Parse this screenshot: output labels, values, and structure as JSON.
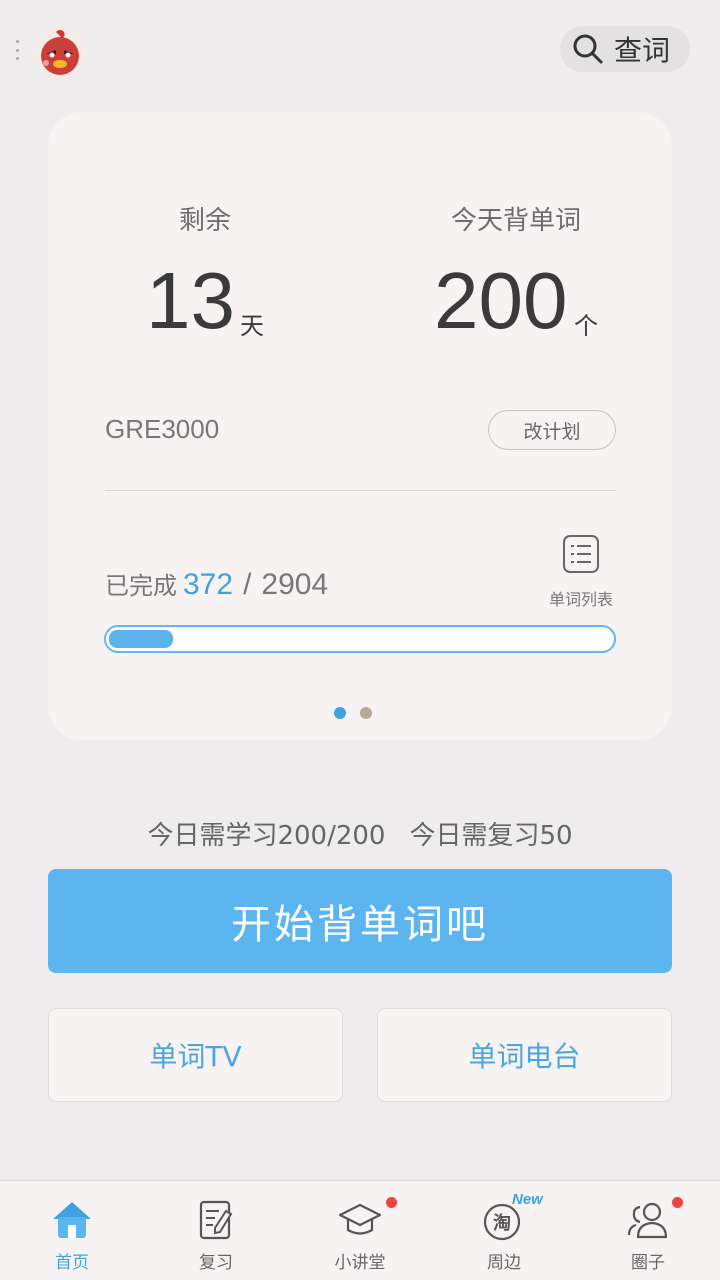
{
  "header": {
    "search_label": "查词"
  },
  "plan_card": {
    "remaining_label": "剩余",
    "remaining_value": "13",
    "remaining_unit": "天",
    "daily_label": "今天背单词",
    "daily_value": "200",
    "daily_unit": "个",
    "book_name": "GRE3000",
    "change_plan_label": "改计划",
    "completed_label": "已完成",
    "completed_count": "372",
    "separator": "/",
    "total_count": "2904",
    "progress_fraction": 0.128,
    "word_list_label": "单词列表",
    "page_indicator": {
      "count": 2,
      "active": 0
    }
  },
  "today": {
    "learn_text": "今日需学习200/200",
    "review_text": "今日需复习50"
  },
  "actions": {
    "start_label": "开始背单词吧",
    "tv_label": "单词TV",
    "radio_label": "单词电台"
  },
  "tabbar": {
    "items": [
      {
        "label": "首页",
        "icon": "home-icon",
        "active": true
      },
      {
        "label": "复习",
        "icon": "review-icon",
        "active": false
      },
      {
        "label": "小讲堂",
        "icon": "graduation-cap-icon",
        "active": false,
        "badge": true
      },
      {
        "label": "周边",
        "icon": "taobao-icon",
        "active": false,
        "tag": "New"
      },
      {
        "label": "圈子",
        "icon": "people-icon",
        "active": false,
        "badge": true
      }
    ]
  },
  "colors": {
    "accent": "#5db5f0",
    "accent_text": "#3fa2e0",
    "badge": "#e94545",
    "card_bg": "#f8f3f3",
    "page_bg": "#eeecec"
  }
}
